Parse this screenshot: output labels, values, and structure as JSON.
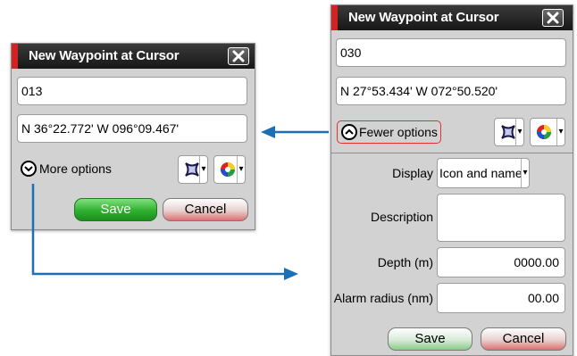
{
  "dialog_small": {
    "title": "New Waypoint at Cursor",
    "name_value": "013",
    "position_value": "N 36°22.772'  W 096°09.467'",
    "more_options_label": "More options",
    "save_label": "Save",
    "cancel_label": "Cancel"
  },
  "dialog_large": {
    "title": "New Waypoint at Cursor",
    "name_value": "030",
    "position_value": "N 27°53.434'  W 072°50.520'",
    "fewer_options_label": "Fewer options",
    "display_label": "Display",
    "display_value": "Icon and name",
    "description_label": "Description",
    "description_value": "",
    "depth_label": "Depth (m)",
    "depth_value": "0000.00",
    "alarm_label": "Alarm radius (nm)",
    "alarm_value": "00.00",
    "save_label": "Save",
    "cancel_label": "Cancel"
  },
  "icons": {
    "close": "close-icon",
    "symbol": "waypoint-symbol-icon",
    "color": "color-wheel-icon",
    "expand": "chevron-down-icon",
    "collapse": "chevron-up-icon",
    "dropdown": "dropdown-arrow-icon"
  },
  "colors": {
    "title_accent": "#d42222",
    "arrow": "#1a6fb5",
    "save_green": "#2fb02f"
  }
}
